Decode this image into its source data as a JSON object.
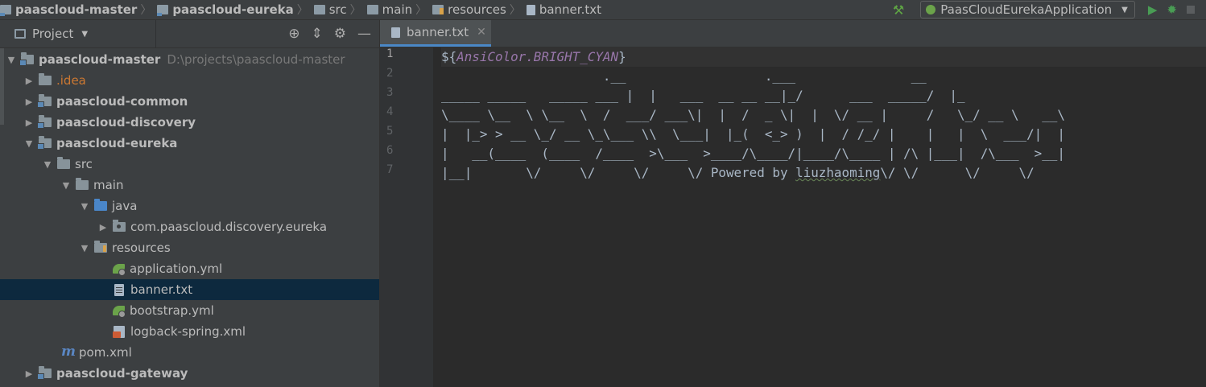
{
  "breadcrumb": {
    "items": [
      "paascloud-master",
      "paascloud-eureka",
      "src",
      "main",
      "resources",
      "banner.txt"
    ]
  },
  "run_config": {
    "name": "PaasCloudEurekaApplication"
  },
  "project_panel": {
    "title": "Project",
    "tree": [
      {
        "label": "paascloud-master",
        "path": "D:\\projects\\paascloud-master"
      },
      {
        "label": ".idea"
      },
      {
        "label": "paascloud-common"
      },
      {
        "label": "paascloud-discovery"
      },
      {
        "label": "paascloud-eureka"
      },
      {
        "label": "src"
      },
      {
        "label": "main"
      },
      {
        "label": "java"
      },
      {
        "label": "com.paascloud.discovery.eureka"
      },
      {
        "label": "resources"
      },
      {
        "label": "application.yml"
      },
      {
        "label": "banner.txt"
      },
      {
        "label": "bootstrap.yml"
      },
      {
        "label": "logback-spring.xml"
      },
      {
        "label": "pom.xml"
      },
      {
        "label": "paascloud-gateway"
      }
    ]
  },
  "editor": {
    "tab_label": "banner.txt",
    "line_numbers": [
      "1",
      "2",
      "3",
      "4",
      "5",
      "6",
      "7"
    ],
    "lines": {
      "l1_prefix": "${",
      "l1_var": "AnsiColor.BRIGHT_CYAN",
      "l1_suffix": "}",
      "l2": "                     .__                  .___               __",
      "l3": "_____ _____   _____ ___ |  |   ___  __ __ __|_/      ___  _____/  |_",
      "l4": "\\____ \\__  \\ \\__  \\  /  ___/ ___\\|  |  /  _ \\|  |  \\/ __ |     /   \\_/ __ \\   __\\",
      "l5": "|  |_> > __ \\_/ __ \\_\\___ \\\\  \\___|  |_(  <_> )  |  / /_/ |    |   |  \\  ___/|  |",
      "l6": "|   __(____  (____  /____  >\\___  >____/\\____/|____/\\____ | /\\ |___|  /\\___  >__|",
      "l7_prefix": "|__|       \\/     \\/     \\/     \\/ Powered by ",
      "l7_name": "liuzhaoming",
      "l7_suffix": "\\/ \\/      \\/     \\/"
    }
  }
}
